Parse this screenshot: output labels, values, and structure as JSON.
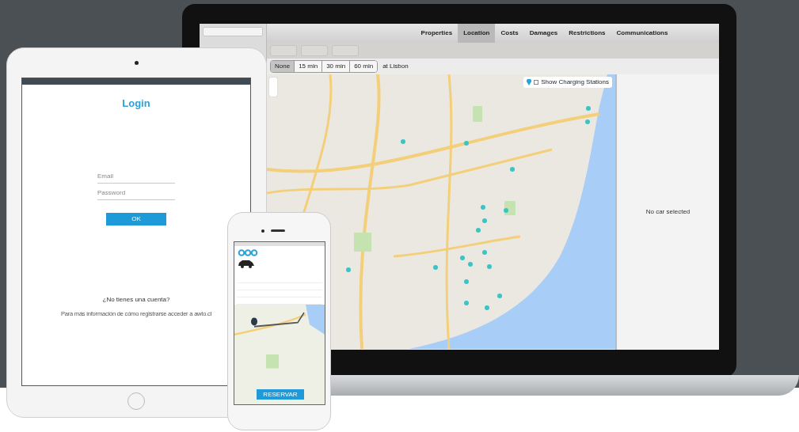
{
  "laptop": {
    "tabs": [
      {
        "label": "Properties",
        "selected": false
      },
      {
        "label": "Location",
        "selected": true
      },
      {
        "label": "Costs",
        "selected": false
      },
      {
        "label": "Damages",
        "selected": false
      },
      {
        "label": "Restrictions",
        "selected": false
      },
      {
        "label": "Communications",
        "selected": false
      }
    ],
    "toolbar_buttons": [
      {
        "disabled": true
      },
      {
        "disabled": true
      },
      {
        "disabled": true
      }
    ],
    "time_filters": [
      {
        "label": "None",
        "selected": true
      },
      {
        "label": "15 min",
        "selected": false
      },
      {
        "label": "30 min",
        "selected": false
      },
      {
        "label": "60 min",
        "selected": false
      }
    ],
    "location_label": "at Lisbon",
    "charging_toggle": {
      "label": "Show Charging Stations",
      "checked": false
    },
    "detail_message": "No car selected"
  },
  "tablet": {
    "title": "Login",
    "fields": [
      {
        "placeholder": "Email"
      },
      {
        "placeholder": "Password"
      }
    ],
    "button": "OK",
    "signup_question": "¿No tienes una cuenta?",
    "signup_info": "Para más información de cómo registrarse acceder a awto.cl"
  },
  "phone": {
    "button": "RESERVAR"
  }
}
